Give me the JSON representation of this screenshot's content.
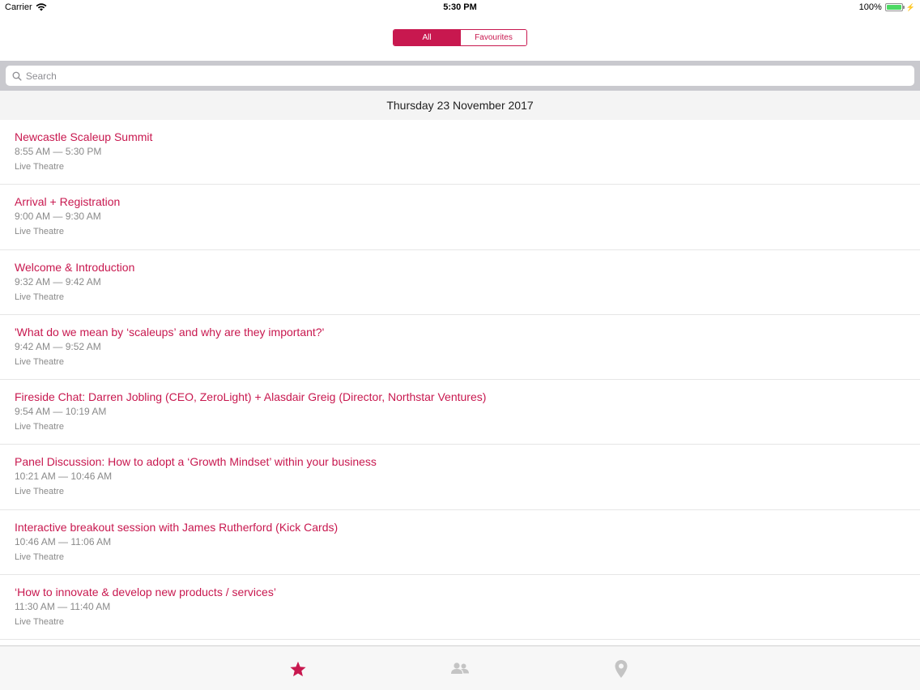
{
  "status_bar": {
    "carrier": "Carrier",
    "time": "5:30 PM",
    "battery_percent": "100%",
    "battery_level": 1.0
  },
  "segmented_control": {
    "segments": [
      "All",
      "Favourites"
    ],
    "selected": "All"
  },
  "search": {
    "placeholder": "Search",
    "value": ""
  },
  "date_header": "Thursday 23 November 2017",
  "events": [
    {
      "title": "Newcastle Scaleup Summit",
      "time": "8:55 AM — 5:30 PM",
      "venue": "Live Theatre"
    },
    {
      "title": "Arrival + Registration",
      "time": "9:00 AM — 9:30 AM",
      "venue": "Live Theatre"
    },
    {
      "title": "Welcome & Introduction",
      "time": "9:32 AM — 9:42 AM",
      "venue": "Live Theatre"
    },
    {
      "title": "'What do we mean by ‘scaleups’ and why are they important?'",
      "time": "9:42 AM — 9:52 AM",
      "venue": "Live Theatre"
    },
    {
      "title": "Fireside Chat: Darren Jobling (CEO, ZeroLight) + Alasdair Greig (Director, Northstar Ventures)",
      "time": "9:54 AM — 10:19 AM",
      "venue": "Live Theatre"
    },
    {
      "title": "Panel Discussion: How to adopt a ‘Growth Mindset’ within your business",
      "time": "10:21 AM — 10:46 AM",
      "venue": "Live Theatre"
    },
    {
      "title": "Interactive breakout session with James Rutherford (Kick Cards)",
      "time": "10:46 AM — 11:06 AM",
      "venue": "Live Theatre"
    },
    {
      "title": "‘How to innovate & develop new products / services’",
      "time": "11:30 AM — 11:40 AM",
      "venue": "Live Theatre"
    }
  ],
  "tab_bar": {
    "tabs": [
      {
        "icon": "star-icon",
        "selected": true
      },
      {
        "icon": "people-icon",
        "selected": false
      },
      {
        "icon": "location-pin-icon",
        "selected": false
      }
    ]
  },
  "colors": {
    "accent": "#c8184f",
    "secondary_text": "#8a8a8a",
    "inactive_icon": "#c4c4c4",
    "battery": "#4cd964"
  }
}
